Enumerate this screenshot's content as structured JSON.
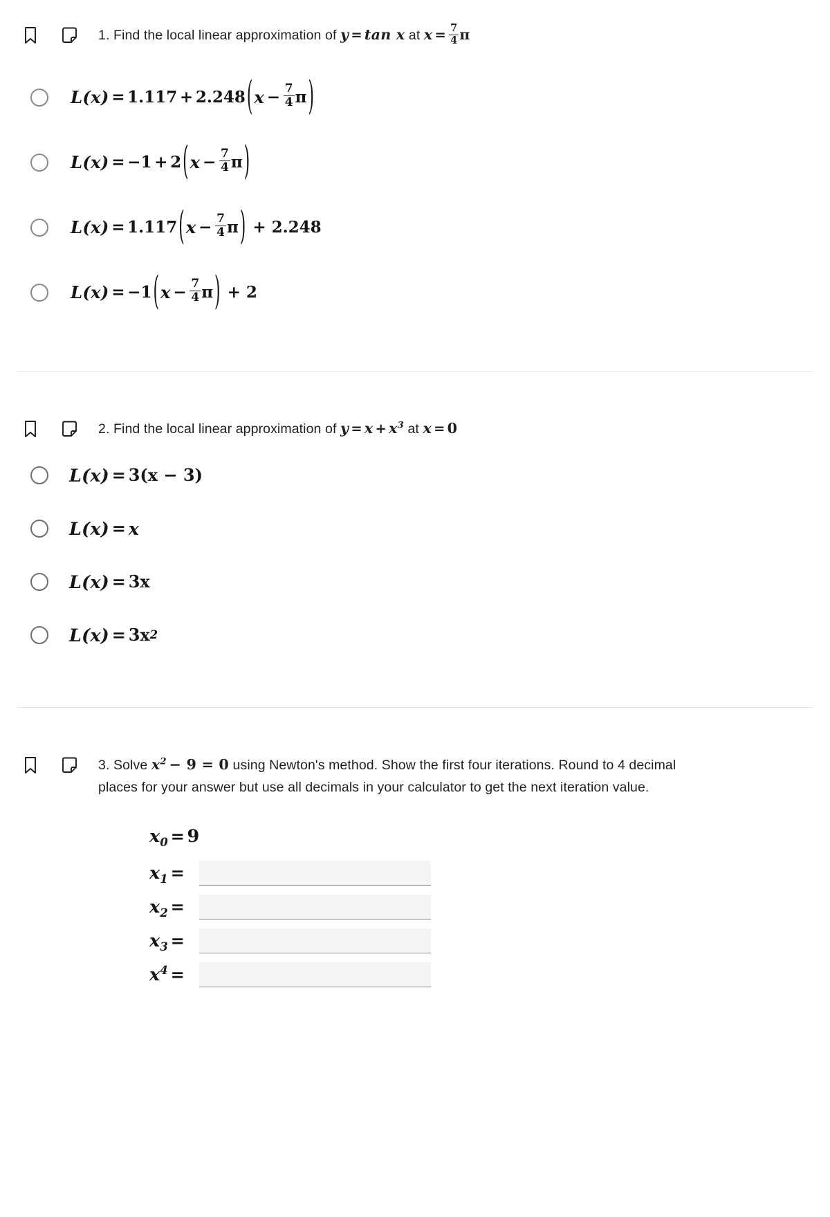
{
  "page": {
    "background": "#ffffff",
    "text_color": "#1c1c1c",
    "divider_color": "#e3e3e3",
    "input_fill": "#f4f4f4",
    "input_underline": "#8f8f8f",
    "radio_border": "#8a8a8a"
  },
  "icons": {
    "bookmark": "bookmark-icon",
    "note": "sticky-note-icon"
  },
  "questions": [
    {
      "number": "1.",
      "prompt_before": "Find the local linear approximation of",
      "fn_y": "y",
      "fn_eq": "=",
      "fn_expr": "tan x",
      "at_word": "at",
      "var_x": "x",
      "at_eq": "=",
      "at_value_num": "7",
      "at_value_den": "4",
      "at_value_sym": "π",
      "options": [
        {
          "id": "q1-opt-1",
          "lhs": "L(x)",
          "eq": "=",
          "coef_a": "1.117",
          "plus": "+",
          "coef_b": "2.248",
          "inner_var": "x",
          "minus": "−",
          "frac_num": "7",
          "frac_den": "4",
          "pi": "π",
          "trailing": ""
        },
        {
          "id": "q1-opt-2",
          "lhs": "L(x)",
          "eq": "=",
          "coef_a": "−1",
          "plus": "+",
          "coef_b": "2",
          "inner_var": "x",
          "minus": "−",
          "frac_num": "7",
          "frac_den": "4",
          "pi": "π",
          "trailing": ""
        },
        {
          "id": "q1-opt-3",
          "lhs": "L(x)",
          "eq": "=",
          "coef_a": "1.117",
          "plus": "",
          "coef_b": "",
          "inner_var": "x",
          "minus": "−",
          "frac_num": "7",
          "frac_den": "4",
          "pi": "π",
          "trailing": "+ 2.248"
        },
        {
          "id": "q1-opt-4",
          "lhs": "L(x)",
          "eq": "=",
          "coef_a": "−1",
          "plus": "",
          "coef_b": "",
          "inner_var": "x",
          "minus": "−",
          "frac_num": "7",
          "frac_den": "4",
          "pi": "π",
          "trailing": "+ 2"
        }
      ]
    },
    {
      "number": "2.",
      "prompt_before": "Find the local linear approximation of",
      "fn_y": "y",
      "fn_eq": "=",
      "fn_base": "x",
      "fn_plus": "+",
      "fn_pow_base": "x",
      "fn_pow_exp": "3",
      "at_word": "at",
      "var_x": "x",
      "at_eq": "=",
      "at_value": "0",
      "options": [
        {
          "id": "q2-opt-1",
          "lhs": "L(x)",
          "eq": "=",
          "rhs": "3(x − 3)"
        },
        {
          "id": "q2-opt-2",
          "lhs": "L(x)",
          "eq": "=",
          "rhs": "x"
        },
        {
          "id": "q2-opt-3",
          "lhs": "L(x)",
          "eq": "=",
          "rhs": "3x"
        },
        {
          "id": "q2-opt-4",
          "lhs": "L(x)",
          "eq": "=",
          "rhs_base": "3x",
          "rhs_exp": "2"
        }
      ]
    },
    {
      "number": "3.",
      "solve_word": "Solve",
      "equation_base": "x",
      "equation_exp": "2",
      "equation_rest": "− 9 = 0",
      "line1_rest": "using Newton's method. Show the first four iterations. Round to",
      "line2": "4 decimal places for your answer but use all decimals in your calculator to get the",
      "line3": "next iteration value.",
      "iterations": [
        {
          "id": "x0",
          "label_base": "x",
          "label_sub": "0",
          "label_sup": "",
          "eq": "=",
          "value": "9",
          "is_input": false,
          "input_value": "",
          "placeholder": ""
        },
        {
          "id": "x1",
          "label_base": "x",
          "label_sub": "1",
          "label_sup": "",
          "eq": "=",
          "value": "",
          "is_input": true,
          "input_value": "",
          "placeholder": ""
        },
        {
          "id": "x2",
          "label_base": "x",
          "label_sub": "2",
          "label_sup": "",
          "eq": "=",
          "value": "",
          "is_input": true,
          "input_value": "",
          "placeholder": ""
        },
        {
          "id": "x3",
          "label_base": "x",
          "label_sub": "3",
          "label_sup": "",
          "eq": "=",
          "value": "",
          "is_input": true,
          "input_value": "",
          "placeholder": ""
        },
        {
          "id": "x4",
          "label_base": "x",
          "label_sub": "",
          "label_sup": "4",
          "eq": "=",
          "value": "",
          "is_input": true,
          "input_value": "",
          "placeholder": ""
        }
      ]
    }
  ]
}
